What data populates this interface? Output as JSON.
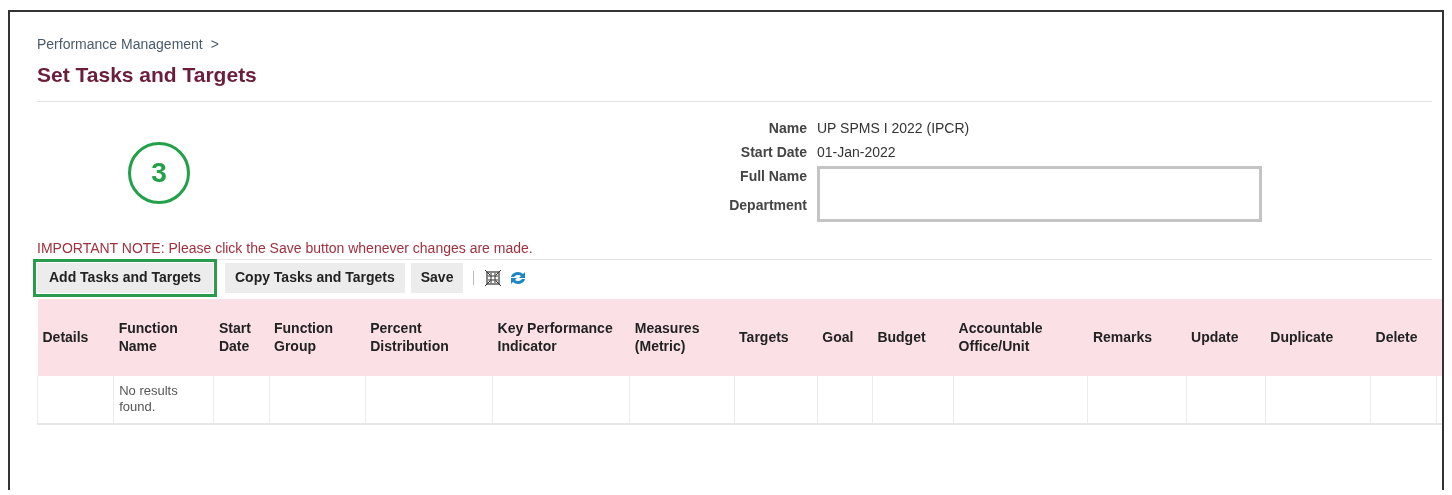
{
  "breadcrumb": {
    "label": "Performance Management",
    "separator": ">"
  },
  "title": "Set Tasks and Targets",
  "step_marker": "3",
  "fields": [
    {
      "label": "Name",
      "kind": "text",
      "value": "UP SPMS I 2022 (IPCR)"
    },
    {
      "label": "Start Date",
      "kind": "text",
      "value": "01-Jan-2022"
    },
    {
      "label": "Full Name",
      "kind": "box"
    },
    {
      "label": "Department",
      "kind": "box"
    }
  ],
  "note": "IMPORTANT NOTE: Please click the Save button whenever changes are made.",
  "toolbar": [
    {
      "label": "Add Tasks and Targets",
      "highlighted": true
    },
    {
      "label": "Copy Tasks and Targets",
      "highlighted": false
    },
    {
      "label": "Save",
      "highlighted": false
    }
  ],
  "table": {
    "columns": [
      "Details",
      "Function Name",
      "Start Date",
      "Function Group",
      "Percent Distribution",
      "Key Performance Indicator",
      "Measures (Metric)",
      "Targets",
      "Goal",
      "Budget",
      "Accountable Office/Unit",
      "Remarks",
      "Update",
      "Duplicate",
      "Delete"
    ],
    "empty_text": "No results found."
  }
}
